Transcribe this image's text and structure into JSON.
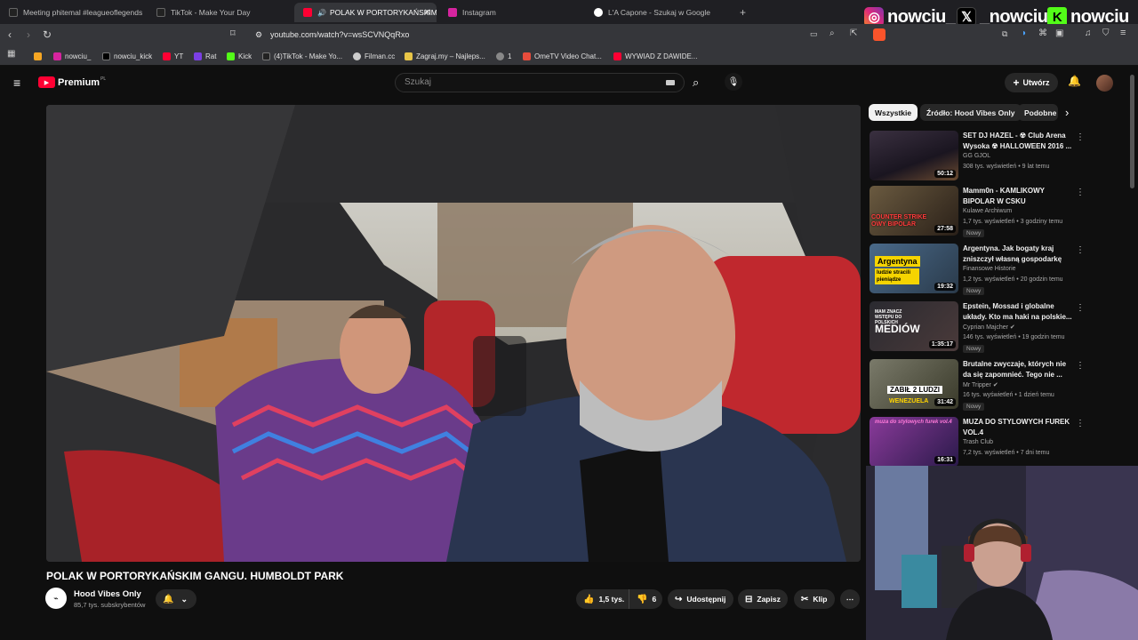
{
  "browser": {
    "tabs": [
      {
        "label": "Meeting phitemal #leagueoflegends",
        "icon_color": "#111111"
      },
      {
        "label": "TikTok - Make Your Day",
        "icon_color": "#111111"
      },
      {
        "label": "POLAK W PORTORYKAŃSKIM",
        "icon_color": "#ff0033",
        "active": true
      },
      {
        "label": "Instagram",
        "icon_color": "#d6249f"
      },
      {
        "label": "L'A Capone - Szukaj w Google",
        "icon_color": "#4285f4"
      }
    ],
    "new_tab": "+",
    "url": "youtube.com/watch?v=wsSCVNQqRxo",
    "bookmarks": [
      {
        "label": "",
        "icon_color": "#f5a623"
      },
      {
        "label": "nowciu_",
        "icon_color": "#d6249f"
      },
      {
        "label": "nowciu_kick",
        "icon_color": "#000000"
      },
      {
        "label": "YT",
        "icon_color": "#ff0033"
      },
      {
        "label": "Rat",
        "icon_color": "#7b3fe4"
      },
      {
        "label": "Kick",
        "icon_color": "#53fc18"
      },
      {
        "label": "(4)TikTok - Make Yo...",
        "icon_color": "#111111"
      },
      {
        "label": "Filman.cc",
        "icon_color": "#cccccc"
      },
      {
        "label": "Zagraj.my – Najleps...",
        "icon_color": "#e8c547"
      },
      {
        "label": "1",
        "icon_color": "#888888"
      },
      {
        "label": "OmeTV Video Chat...",
        "icon_color": "#e74c3c"
      },
      {
        "label": "WYWIAD Z DAWIDE...",
        "icon_color": "#ff0033"
      }
    ]
  },
  "overlay": {
    "instagram": "nowciu_",
    "x": "_nowciu",
    "kick": "nowciu"
  },
  "youtube": {
    "logo_text": "Premium",
    "logo_region": "PL",
    "search_placeholder": "Szukaj",
    "create_label": "Utwórz",
    "video": {
      "title": "POLAK W PORTORYKAŃSKIM GANGU. HUMBOLDT PARK",
      "channel": "Hood Vibes Only",
      "subscribers": "85,7 tys. subskrybentów",
      "likes": "1,5 tys.",
      "dislikes": "6",
      "share": "Udostępnij",
      "save": "Zapisz",
      "clip": "Klip"
    },
    "chips": [
      "Wszystkie",
      "Źródło: Hood Vibes Only",
      "Podobne"
    ],
    "recommendations": [
      {
        "title": "SET DJ HAZEL - ☢ Club Arena Wysoka ☢ HALLOWEEN 2016 ...",
        "channel": "GG GJOL",
        "meta": "308 tys. wyświetleń • 9 lat temu",
        "duration": "50:12",
        "badge": "",
        "thumb": "#2a2a34"
      },
      {
        "title": "Mamm0n - KAMLIKOWY BIPOLAR W CSKU",
        "channel": "Kulawe Archiwum",
        "meta": "1,7 tys. wyświetleń • 3 godziny temu",
        "duration": "27:58",
        "badge": "Nowy",
        "thumb": "#5a4a30"
      },
      {
        "title": "Argentyna. Jak bogaty kraj zniszczył własną gospodarkę",
        "channel": "Finansowe Historie",
        "meta": "1,2 tys. wyświetleń • 20 godzin temu",
        "duration": "19:32",
        "badge": "Nowy",
        "thumb": "#3a4a5a"
      },
      {
        "title": "Epstein, Mossad i globalne układy. Kto ma haki na polskie...",
        "channel": "Cyprian Majcher",
        "meta": "146 tys. wyświetleń • 19 godzin temu",
        "duration": "1:35:17",
        "badge": "Nowy",
        "thumb": "#302a2a"
      },
      {
        "title": "Brutalne zwyczaje, których nie da się zapomnieć. Tego nie ...",
        "channel": "Mr Tripper",
        "meta": "16 tys. wyświetleń • 1 dzień temu",
        "duration": "31:42",
        "badge": "Nowy",
        "thumb": "#4a4a3a"
      },
      {
        "title": "MUZA DO STYLOWYCH FUREK VOL.4",
        "channel": "Trash Club",
        "meta": "7,2 tys. wyświetleń • 7 dni temu",
        "duration": "16:31",
        "badge": "",
        "thumb": "#4a2a6a"
      }
    ],
    "thumb_text": {
      "mammon": "COUNTER STRIKE OWY BIPOLAR",
      "argentyna": "Argentyna",
      "argentyna_sub": "ludzie stracili pieniądze",
      "epstein": "MEDIÓW",
      "epstein_sub": "MAM ZNACZ WSTĘPU DO POLSKICH",
      "brutalne": "ZABIŁ 2 LUDZI",
      "brutalne_sub": "WENEZUELA",
      "muza": "muza do stylowych furek vol.4"
    }
  },
  "colors": {
    "bg": "#0f0f0f",
    "youtube_red": "#ff0033",
    "kick_green": "#53fc18"
  }
}
